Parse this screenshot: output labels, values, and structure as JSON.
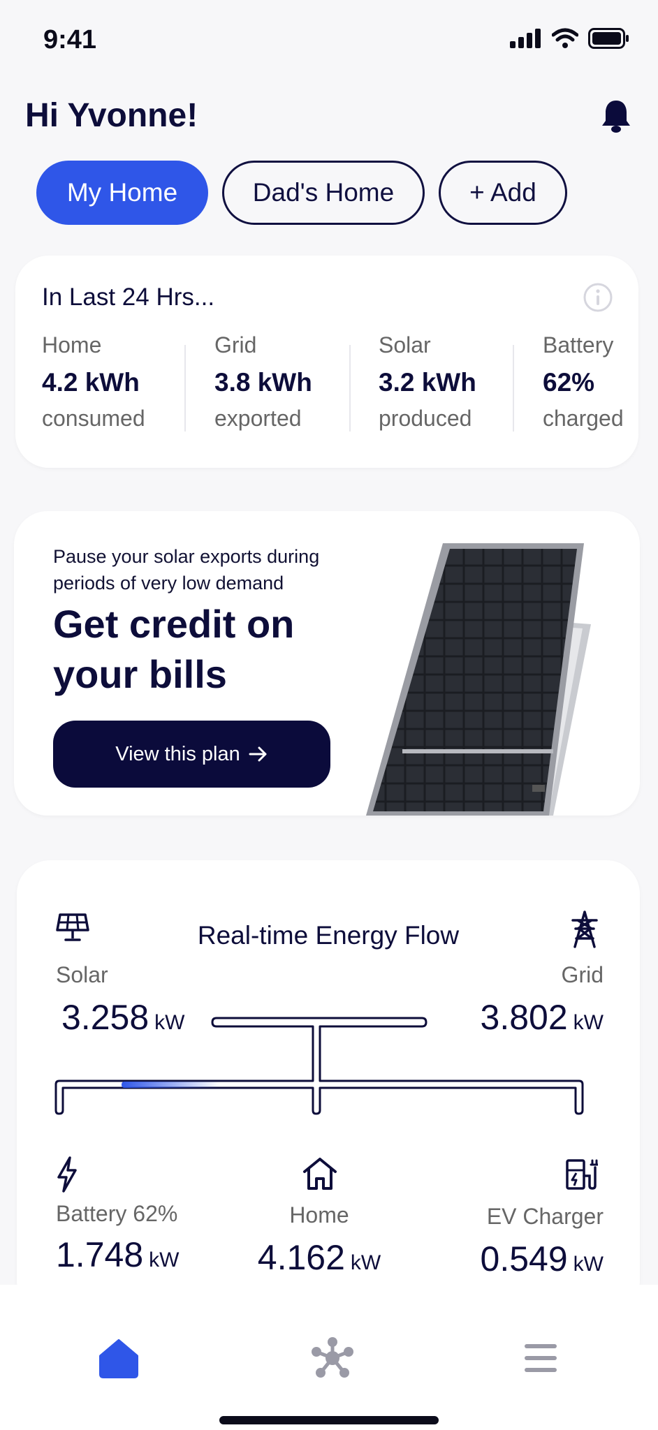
{
  "status_bar": {
    "time": "9:41"
  },
  "greeting": "Hi Yvonne!",
  "homes": [
    {
      "label": "My Home",
      "active": true
    },
    {
      "label": "Dad's Home",
      "active": false
    },
    {
      "label": "+ Add",
      "active": false
    }
  ],
  "summary": {
    "title": "In Last 24 Hrs...",
    "stats": [
      {
        "label": "Home",
        "value": "4.2 kWh",
        "sub": "consumed"
      },
      {
        "label": "Grid",
        "value": "3.8 kWh",
        "sub": "exported"
      },
      {
        "label": "Solar",
        "value": "3.2 kWh",
        "sub": "produced"
      },
      {
        "label": "Battery",
        "value": "62%",
        "sub": "charged"
      }
    ]
  },
  "promo": {
    "small_text": "Pause your solar exports during periods of very low demand",
    "headline": "Get credit on your bills",
    "button_label": "View this plan"
  },
  "energy_flow": {
    "title": "Real-time Energy Flow",
    "nodes": {
      "solar": {
        "label": "Solar",
        "value": "3.258",
        "unit": "kW"
      },
      "grid": {
        "label": "Grid",
        "value": "3.802",
        "unit": "kW"
      },
      "battery": {
        "label": "Battery 62%",
        "value": "1.748",
        "unit": "kW"
      },
      "home": {
        "label": "Home",
        "value": "4.162",
        "unit": "kW"
      },
      "ev": {
        "label": "EV Charger",
        "value": "0.549",
        "unit": "kW"
      }
    }
  },
  "nav": {
    "items": [
      {
        "icon": "home-icon",
        "active": true
      },
      {
        "icon": "network-icon",
        "active": false
      },
      {
        "icon": "menu-icon",
        "active": false
      }
    ]
  },
  "colors": {
    "accent": "#2f56e8",
    "navy": "#0b0b3b",
    "muted": "#666666"
  }
}
